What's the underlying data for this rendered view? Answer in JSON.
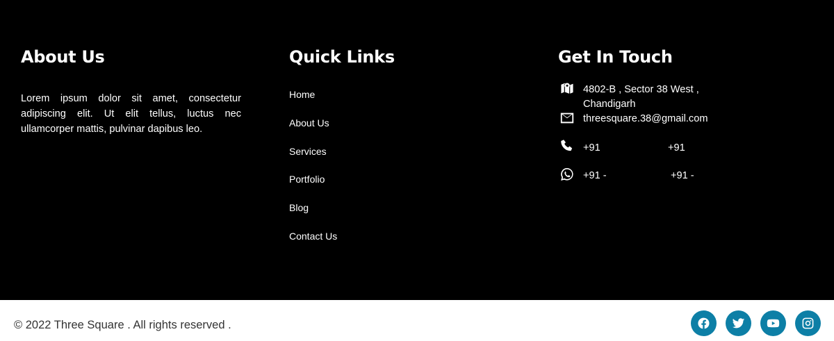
{
  "about": {
    "heading": "About Us",
    "text": "Lorem ipsum dolor sit amet, consectetur adipiscing elit. Ut elit tellus, luctus nec ullamcorper mattis, pulvinar dapibus leo."
  },
  "quick_links": {
    "heading": "Quick Links",
    "items": [
      "Home",
      "About Us",
      "Services",
      "Portfolio",
      "Blog",
      "Contact Us"
    ]
  },
  "contact": {
    "heading": "Get In Touch",
    "address_line1": "4802-B , Sector 38 West ,",
    "address_line2": "Chandigarh",
    "email": "threesquare.38@gmail.com",
    "phone_1": "+91",
    "phone_2": "+91",
    "whatsapp_1": "+91 -",
    "whatsapp_2": "+91 -",
    "icons": [
      "map-icon",
      "envelope-icon",
      "phone-icon",
      "whatsapp-icon"
    ]
  },
  "bottom": {
    "copyright": "© 2022 Three Square . All rights reserved .",
    "social_icons": [
      "facebook-icon",
      "twitter-icon",
      "youtube-icon",
      "instagram-icon"
    ],
    "social_color": "#0d7fa6"
  }
}
